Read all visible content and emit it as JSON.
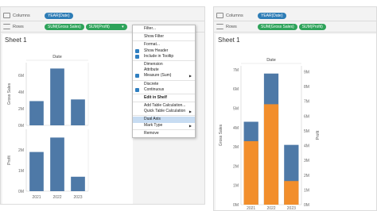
{
  "left": {
    "columns_label": "Columns",
    "rows_label": "Rows",
    "column_pill": "YEAR(Date)",
    "row_pills": [
      "SUM(Gross Sales)",
      "SUM(Profit)"
    ],
    "sheet_title": "Sheet 1"
  },
  "right": {
    "columns_label": "Columns",
    "rows_label": "Rows",
    "column_pill": "YEAR(Date)",
    "row_pills": [
      "SUM(Gross Sales)",
      "SUM(Profit)"
    ],
    "sheet_title": "Sheet 1"
  },
  "menu": {
    "items": [
      {
        "label": "Filter...",
        "check": false,
        "arrow": false,
        "bold": false
      },
      {
        "sep": true
      },
      {
        "label": "Show Filter",
        "check": false,
        "arrow": false,
        "bold": false
      },
      {
        "sep": true
      },
      {
        "label": "Format...",
        "check": false,
        "arrow": false,
        "bold": false
      },
      {
        "label": "Show Header",
        "check": true,
        "arrow": false,
        "bold": false
      },
      {
        "label": "Include in Tooltip",
        "check": true,
        "arrow": false,
        "bold": false
      },
      {
        "sep": true
      },
      {
        "label": "Dimension",
        "check": false,
        "arrow": false,
        "bold": false
      },
      {
        "label": "Attribute",
        "check": false,
        "arrow": false,
        "bold": false
      },
      {
        "label": "Measure (Sum)",
        "check": true,
        "arrow": true,
        "bold": false
      },
      {
        "sep": true
      },
      {
        "label": "Discrete",
        "check": false,
        "arrow": false,
        "bold": false
      },
      {
        "label": "Continuous",
        "check": true,
        "arrow": false,
        "bold": false
      },
      {
        "sep": true
      },
      {
        "label": "Edit in Shelf",
        "check": false,
        "arrow": false,
        "bold": true
      },
      {
        "sep": true
      },
      {
        "label": "Add Table Calculation...",
        "check": false,
        "arrow": false,
        "bold": false
      },
      {
        "label": "Quick Table Calculation",
        "check": false,
        "arrow": true,
        "bold": false
      },
      {
        "sep": true
      },
      {
        "label": "Dual Axis",
        "check": false,
        "arrow": false,
        "bold": false,
        "highlight": true
      },
      {
        "label": "Mark Type",
        "check": false,
        "arrow": true,
        "bold": false
      },
      {
        "sep": true
      },
      {
        "label": "Remove",
        "check": false,
        "arrow": false,
        "bold": false
      }
    ]
  },
  "chart_data": [
    {
      "type": "bar",
      "header": "Date",
      "categories": [
        "2021",
        "2022",
        "2023"
      ],
      "panels": [
        {
          "ylabel": "Gross Sales",
          "values": [
            2.9,
            6.8,
            3.1
          ],
          "ylim": [
            0,
            7.5
          ],
          "ticks": [
            "0M",
            "2M",
            "4M",
            "6M"
          ],
          "tick_values": [
            0,
            2,
            4,
            6
          ]
        },
        {
          "ylabel": "Profit",
          "values": [
            1.9,
            2.6,
            0.7
          ],
          "ylim": [
            0,
            3.0
          ],
          "ticks": [
            "0M",
            "1M",
            "2M"
          ],
          "tick_values": [
            0,
            1,
            2
          ]
        }
      ],
      "color": "#4e79a7"
    },
    {
      "type": "bar",
      "header": "Date",
      "categories": [
        "2021",
        "2022",
        "2023"
      ],
      "ylabel": "Gross Sales",
      "y2label": "Profit",
      "ylim": [
        0,
        7.2
      ],
      "y2lim": [
        0,
        9.4
      ],
      "ticks": [
        "0M",
        "1M",
        "2M",
        "3M",
        "4M",
        "5M",
        "6M",
        "7M"
      ],
      "tick_values": [
        0,
        1,
        2,
        3,
        4,
        5,
        6,
        7
      ],
      "ticks2": [
        "0M",
        "1M",
        "2M",
        "3M",
        "4M",
        "5M",
        "6M",
        "7M",
        "8M",
        "9M"
      ],
      "tick2_values": [
        0,
        1,
        2,
        3,
        4,
        5,
        6,
        7,
        8,
        9
      ],
      "series": [
        {
          "name": "Gross Sales",
          "values": [
            4.3,
            6.8,
            3.1
          ],
          "color": "#4e79a7"
        },
        {
          "name": "Profit",
          "values": [
            4.3,
            6.8,
            1.6
          ],
          "color": "#f28e2b"
        }
      ]
    }
  ]
}
